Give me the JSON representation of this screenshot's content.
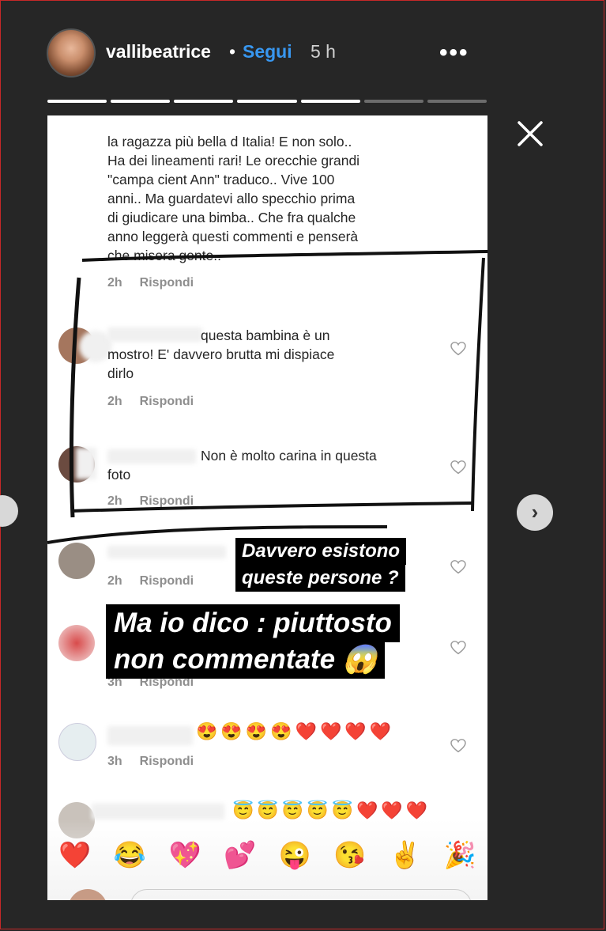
{
  "header": {
    "username": "vallibeatrice",
    "separator": "•",
    "follow_label": "Segui",
    "time": "5 h",
    "more_label": "•••"
  },
  "story_progress": {
    "total": 7,
    "viewed": 5
  },
  "comments": [
    {
      "text": "la ragazza più bella d Italia! E non solo..\nHa dei lineamenti rari! Le orecchie grandi\n\"campa cient Ann\" traduco.. Vive 100\nanni.. Ma guardatevi allo specchio prima\ndi giudicare una bimba.. Che fra qualche\nanno leggerà questi commenti e penserà\nche misera gente..",
      "time": "2h",
      "reply": "Rispondi"
    },
    {
      "text": "questa bambina è un\nmostro! E' davvero brutta mi dispiace\ndirlo",
      "time": "2h",
      "reply": "Rispondi"
    },
    {
      "text": "Non è molto carina in questa\nfoto",
      "time": "2h",
      "reply": "Rispondi"
    },
    {
      "time": "2h",
      "reply": "Rispondi"
    },
    {
      "time": "3h",
      "reply": "Rispondi"
    },
    {
      "text": "😍😍😍😍❤️❤️❤️❤️",
      "time": "3h",
      "reply": "Rispondi"
    },
    {
      "text": "😇😇😇😇😇❤️❤️❤️"
    }
  ],
  "captions": {
    "line1": "Davvero esistono",
    "line2": "queste persone ?",
    "line3": "Ma io dico : piuttosto",
    "line4": "non commentate 😱"
  },
  "emoji_bar": [
    "❤️",
    "😂",
    "💖",
    "💕",
    "😜",
    "😘",
    "✌️",
    "🎉"
  ],
  "colors": {
    "background": "#262626",
    "follow": "#3897f0",
    "frame": "#c62828"
  }
}
